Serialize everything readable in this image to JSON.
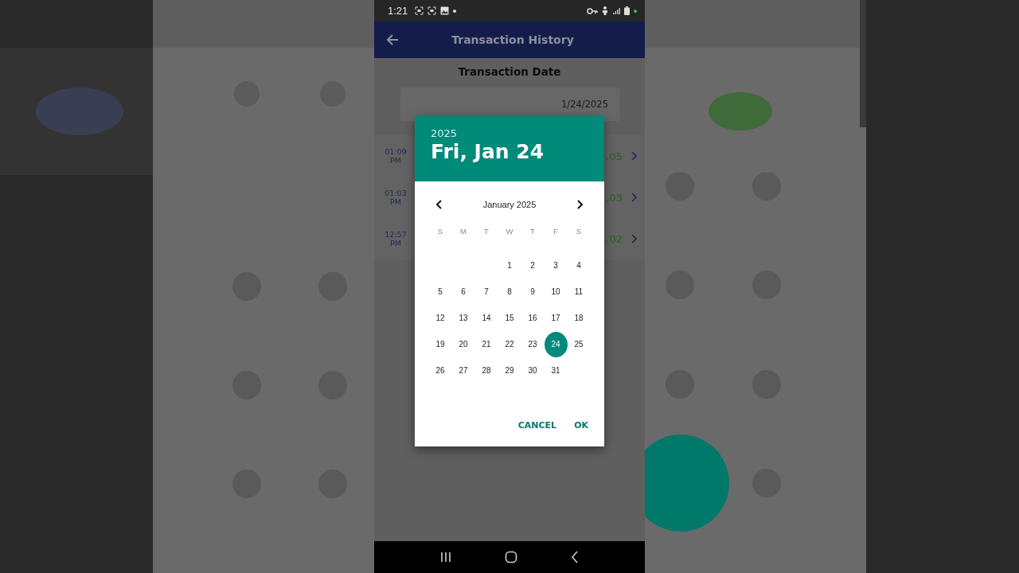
{
  "status_bar": {
    "time": "1:21"
  },
  "app_bar": {
    "title": "Transaction History"
  },
  "filter": {
    "label": "Transaction Date",
    "date_value": "1/24/2025"
  },
  "transactions": [
    {
      "time": "01:09\nPM",
      "amount": ".05"
    },
    {
      "time": "01:03\nPM",
      "amount": ".03"
    },
    {
      "time": "12:57\nPM",
      "amount": ".02"
    }
  ],
  "date_picker": {
    "year": "2025",
    "selected_date": "Fri, Jan 24",
    "month": "January 2025",
    "weekdays": [
      "S",
      "M",
      "T",
      "W",
      "T",
      "F",
      "S"
    ],
    "weeks": [
      [
        {
          "day": "1",
          "selected": false
        },
        {
          "day": "2",
          "selected": false
        },
        {
          "day": "3",
          "selected": false
        },
        {
          "day": "4",
          "selected": false
        }
      ],
      [
        {
          "day": "5",
          "selected": false
        },
        {
          "day": "6",
          "selected": false
        },
        {
          "day": "7",
          "selected": false
        },
        {
          "day": "8",
          "selected": false
        },
        {
          "day": "9",
          "selected": false
        },
        {
          "day": "10",
          "selected": false
        },
        {
          "day": "11",
          "selected": false
        }
      ],
      [
        {
          "day": "12",
          "selected": false
        },
        {
          "day": "13",
          "selected": false
        },
        {
          "day": "14",
          "selected": false
        },
        {
          "day": "15",
          "selected": false
        },
        {
          "day": "16",
          "selected": false
        },
        {
          "day": "17",
          "selected": false
        },
        {
          "day": "18",
          "selected": false
        }
      ],
      [
        {
          "day": "19",
          "selected": false
        },
        {
          "day": "20",
          "selected": false
        },
        {
          "day": "21",
          "selected": false
        },
        {
          "day": "22",
          "selected": false
        },
        {
          "day": "23",
          "selected": false
        },
        {
          "day": "24",
          "selected": true
        },
        {
          "day": "25",
          "selected": false
        }
      ],
      [
        {
          "day": "26",
          "selected": false
        },
        {
          "day": "27",
          "selected": false
        },
        {
          "day": "28",
          "selected": false
        },
        {
          "day": "29",
          "selected": false
        },
        {
          "day": "30",
          "selected": false
        },
        {
          "day": "31",
          "selected": false
        }
      ]
    ],
    "buttons": [
      "CANCEL",
      "OK"
    ]
  }
}
